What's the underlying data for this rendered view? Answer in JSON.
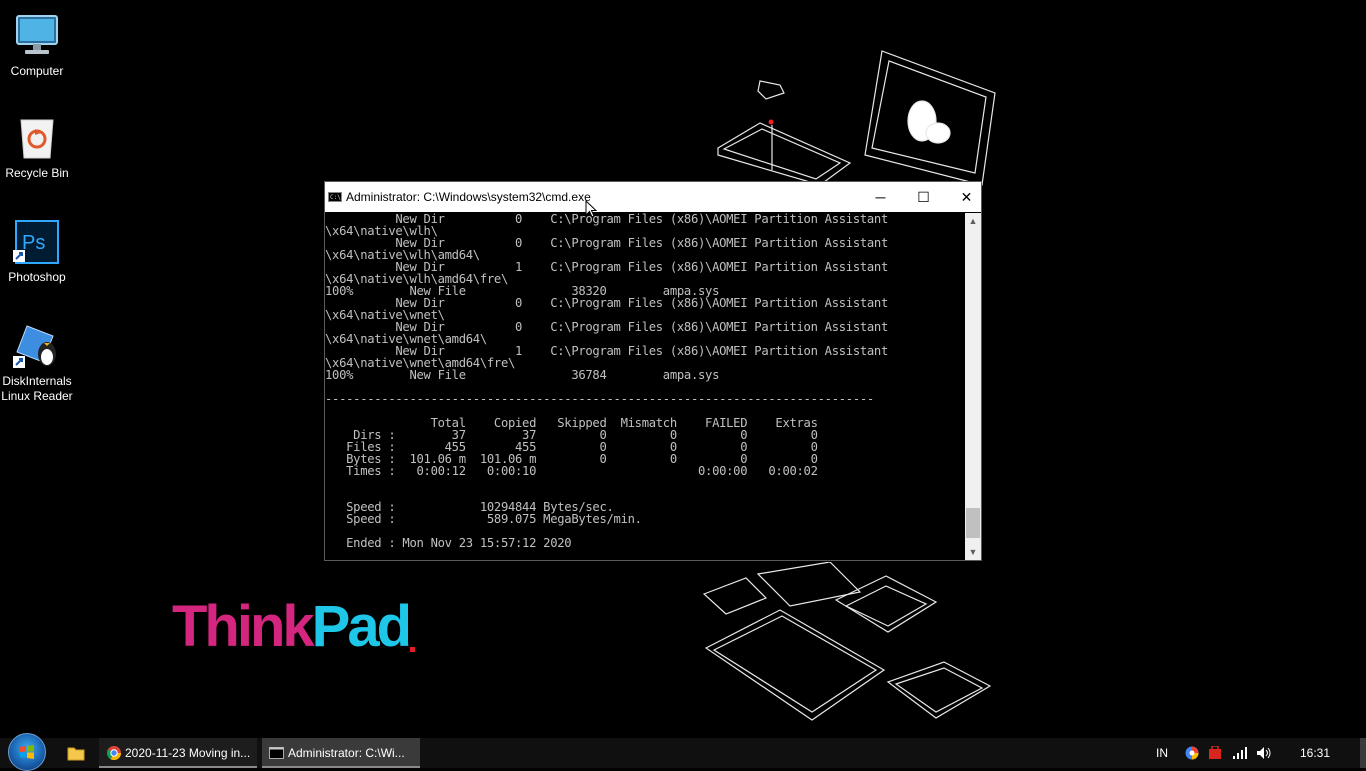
{
  "desktop": {
    "icons": [
      {
        "label": "Computer",
        "icon": "computer-icon"
      },
      {
        "label": "Recycle Bin",
        "icon": "recycle-bin-icon"
      },
      {
        "label": "Photoshop",
        "icon": "photoshop-icon",
        "glyph": "Ps"
      },
      {
        "label_line1": "DiskInternals",
        "label_line2": "Linux Reader",
        "icon": "penguin-icon"
      }
    ],
    "wallpaper_logo": {
      "part1": "Think",
      "part2": "Pad"
    }
  },
  "cmd": {
    "title": "Administrator: C:\\Windows\\system32\\cmd.exe",
    "buttons": {
      "minimize": "─",
      "maximize": "☐",
      "close": "✕"
    },
    "lines": [
      "          New Dir          0    C:\\Program Files (x86)\\AOMEI Partition Assistant",
      "\\x64\\native\\wlh\\",
      "          New Dir          0    C:\\Program Files (x86)\\AOMEI Partition Assistant",
      "\\x64\\native\\wlh\\amd64\\",
      "          New Dir          1    C:\\Program Files (x86)\\AOMEI Partition Assistant",
      "\\x64\\native\\wlh\\amd64\\fre\\",
      "100%        New File               38320        ampa.sys",
      "          New Dir          0    C:\\Program Files (x86)\\AOMEI Partition Assistant",
      "\\x64\\native\\wnet\\",
      "          New Dir          0    C:\\Program Files (x86)\\AOMEI Partition Assistant",
      "\\x64\\native\\wnet\\amd64\\",
      "          New Dir          1    C:\\Program Files (x86)\\AOMEI Partition Assistant",
      "\\x64\\native\\wnet\\amd64\\fre\\",
      "100%        New File               36784        ampa.sys",
      "",
      "------------------------------------------------------------------------------",
      "",
      "               Total    Copied   Skipped  Mismatch    FAILED    Extras",
      "    Dirs :        37        37         0         0         0         0",
      "   Files :       455       455         0         0         0         0",
      "   Bytes :  101.06 m  101.06 m         0         0         0         0",
      "   Times :   0:00:12   0:00:10                       0:00:00   0:00:02",
      "",
      "",
      "   Speed :            10294844 Bytes/sec.",
      "   Speed :             589.075 MegaBytes/min.",
      "",
      "   Ended : Mon Nov 23 15:57:12 2020"
    ],
    "scroll": {
      "up": "▲",
      "down": "▼"
    }
  },
  "taskbar": {
    "chrome_item": "2020-11-23 Moving in...",
    "cmd_item": "Administrator: C:\\Wi...",
    "language": "IN",
    "time": "16:31"
  },
  "colors": {
    "desktop_bg": "#000000",
    "thinkpad_magenta": "#d4257f",
    "thinkpad_cyan": "#1ec7e8",
    "cmd_text": "#c0c0c0"
  }
}
